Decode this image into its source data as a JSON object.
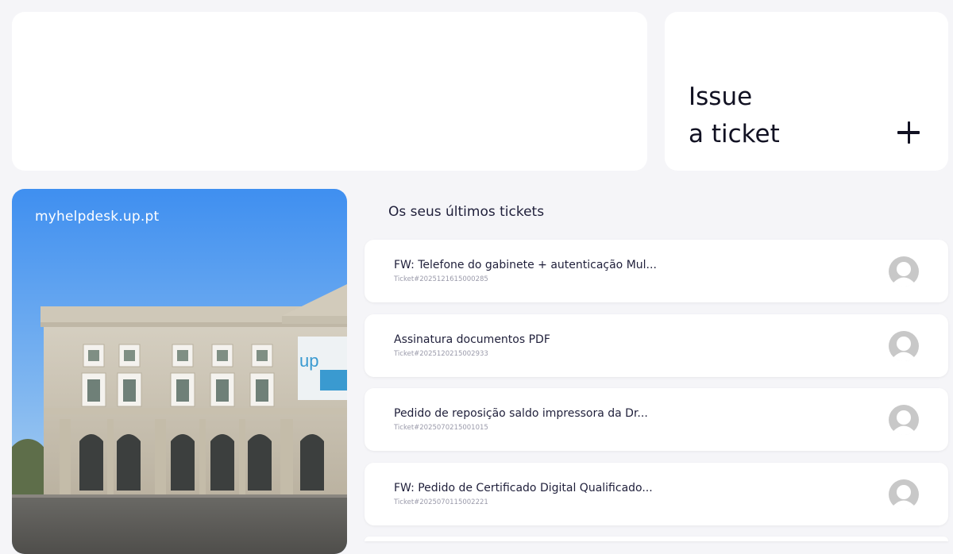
{
  "issue_card": {
    "line1": "Issue",
    "line2": "a ticket",
    "icon": "plus-icon"
  },
  "photo_card": {
    "site_label": "myhelpdesk.up.pt",
    "banner_text": "up"
  },
  "tickets_section": {
    "heading": "Os seus últimos tickets",
    "items": [
      {
        "title": "FW: Telefone do gabinete + autenticação Mul...",
        "id": "Ticket#2025121615000285"
      },
      {
        "title": "Assinatura documentos PDF",
        "id": "Ticket#2025120215002933"
      },
      {
        "title": "Pedido de reposição saldo impressora da Dr...",
        "id": "Ticket#2025070215001015"
      },
      {
        "title": "FW: Pedido de Certificado Digital Qualificado...",
        "id": "Ticket#2025070115002221"
      }
    ]
  },
  "colors": {
    "background": "#f5f5f8",
    "card": "#ffffff",
    "text_primary": "#1f1f3a",
    "text_muted": "#9a9aaa",
    "avatar": "#c8c8c8"
  }
}
